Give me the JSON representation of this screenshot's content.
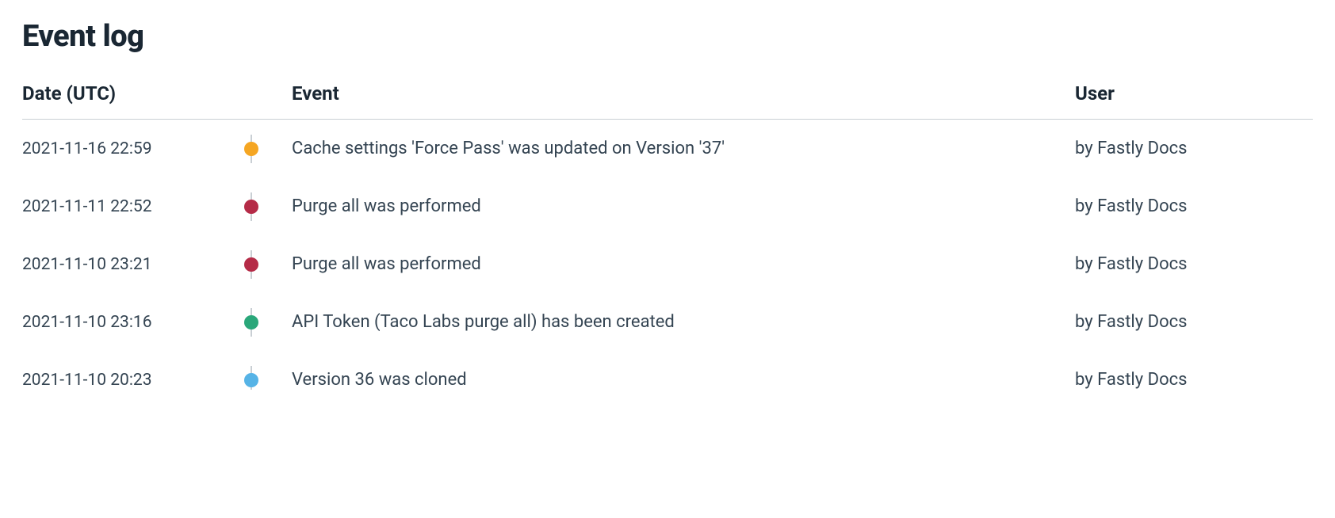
{
  "title": "Event log",
  "columns": {
    "date": "Date (UTC)",
    "event": "Event",
    "user": "User"
  },
  "colors": {
    "orange": "#f5a623",
    "red": "#b52b47",
    "green": "#2aa77a",
    "blue": "#56b3e6"
  },
  "events": [
    {
      "date": "2021-11-16 22:59",
      "description": "Cache settings 'Force Pass' was updated on Version '37'",
      "user": "by Fastly Docs",
      "dot": "orange"
    },
    {
      "date": "2021-11-11 22:52",
      "description": "Purge all was performed",
      "user": "by Fastly Docs",
      "dot": "red"
    },
    {
      "date": "2021-11-10 23:21",
      "description": "Purge all was performed",
      "user": "by Fastly Docs",
      "dot": "red"
    },
    {
      "date": "2021-11-10 23:16",
      "description": "API Token (Taco Labs purge all) has been created",
      "user": "by Fastly Docs",
      "dot": "green"
    },
    {
      "date": "2021-11-10 20:23",
      "description": "Version 36 was cloned",
      "user": "by Fastly Docs",
      "dot": "blue"
    }
  ]
}
